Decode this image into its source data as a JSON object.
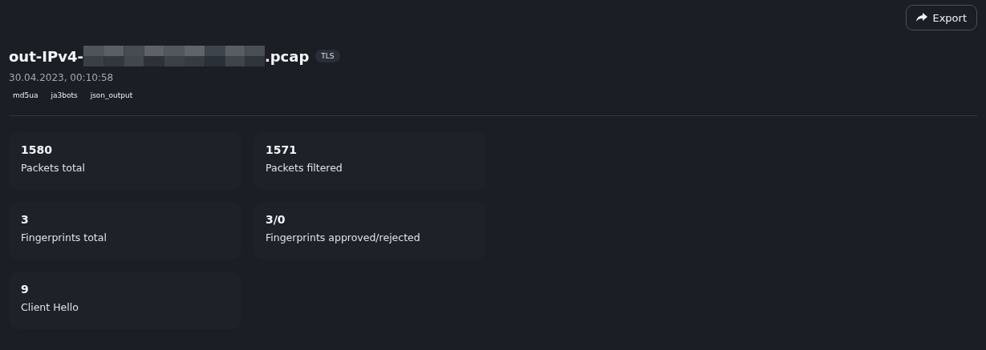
{
  "toolbar": {
    "export_button": "Export"
  },
  "file": {
    "title_prefix": "out-IPv4-",
    "title_suffix": ".pcap",
    "protocol_badge": "TLS",
    "timestamp": "30.04.2023, 00:10:58",
    "tags": [
      "md5ua",
      "ja3bots",
      "json_output"
    ]
  },
  "stats": [
    {
      "value": "1580",
      "label": "Packets total"
    },
    {
      "value": "1571",
      "label": "Packets filtered"
    },
    {
      "value": "3",
      "label": "Fingerprints total"
    },
    {
      "value": "3/0",
      "label": "Fingerprints approved/rejected"
    },
    {
      "value": "9",
      "label": "Client Hello"
    }
  ]
}
